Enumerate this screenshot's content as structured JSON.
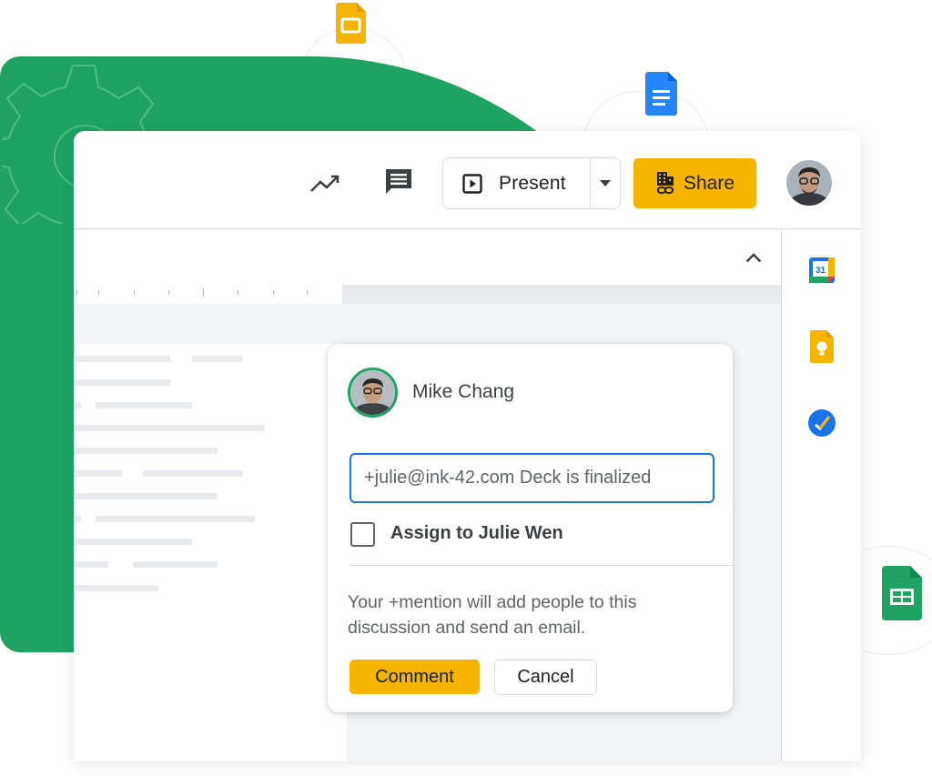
{
  "toolbar": {
    "present_label": "Present",
    "share_label": "Share",
    "accent_color": "#f5b400"
  },
  "comment": {
    "author": "Mike Chang",
    "input_value": "+julie@ink-42.com Deck is finalized",
    "assign_label": "Assign to Julie Wen",
    "assign_checked": false,
    "note": "Your +mention will add people to this discussion and send an email.",
    "comment_button": "Comment",
    "cancel_button": "Cancel"
  },
  "side_panel": {
    "calendar_date": "31",
    "apps": [
      "calendar-icon",
      "keep-icon",
      "tasks-icon"
    ]
  },
  "floating_icons": [
    "slides-icon",
    "docs-icon",
    "sheets-icon"
  ],
  "colors": {
    "brand_green": "#1ea362",
    "focus_blue": "#1a73e8",
    "share_yellow": "#f5b400"
  }
}
